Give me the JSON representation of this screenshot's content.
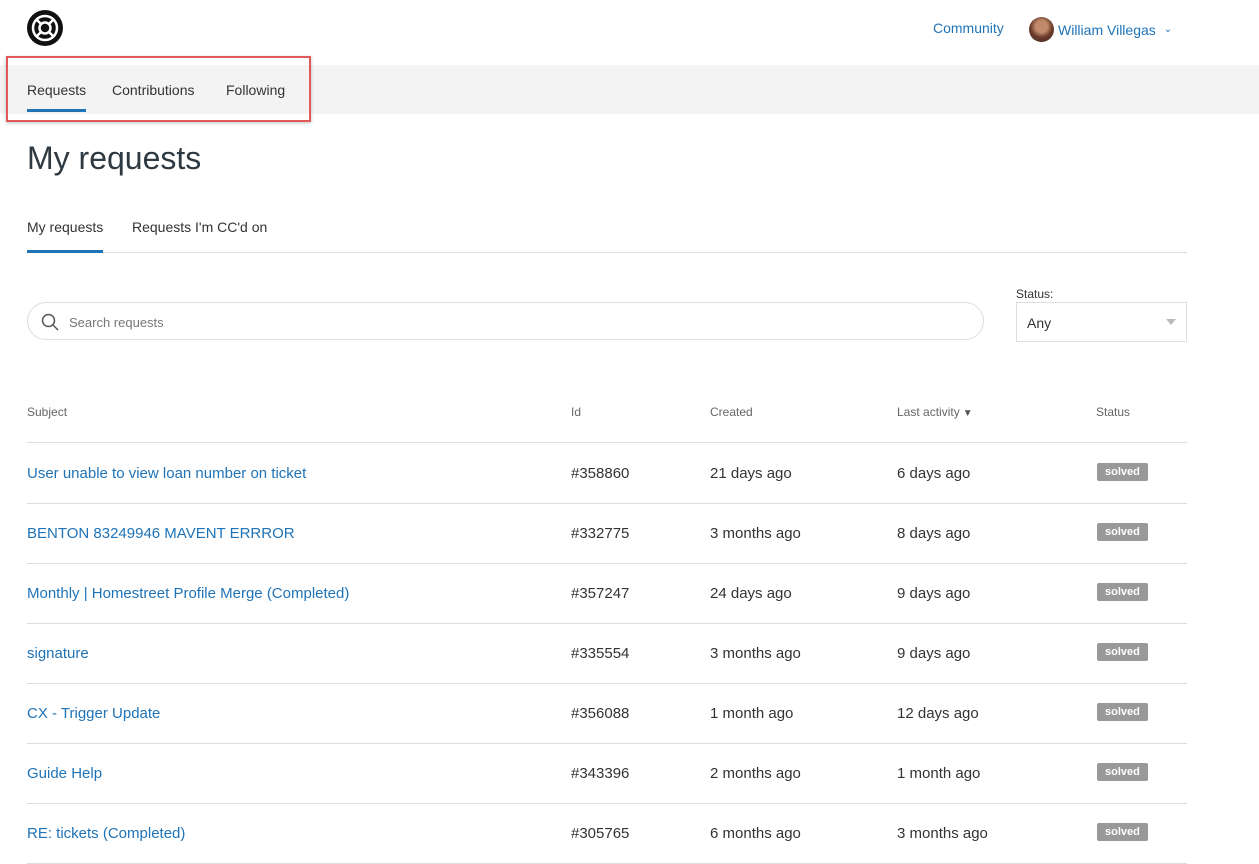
{
  "header": {
    "community_label": "Community",
    "user_name": "William Villegas"
  },
  "subnav": {
    "items": [
      {
        "label": "Requests",
        "active": true
      },
      {
        "label": "Contributions",
        "active": false
      },
      {
        "label": "Following",
        "active": false
      }
    ]
  },
  "page_title": "My requests",
  "tabs": [
    {
      "label": "My requests",
      "active": true
    },
    {
      "label": "Requests I'm CC'd on",
      "active": false
    }
  ],
  "search": {
    "placeholder": "Search requests",
    "value": ""
  },
  "status_filter": {
    "label": "Status:",
    "selected": "Any"
  },
  "table": {
    "columns": [
      "Subject",
      "Id",
      "Created",
      "Last activity",
      "Status"
    ],
    "rows": [
      {
        "subject": "User unable to view loan number on ticket",
        "id": "#358860",
        "created": "21 days ago",
        "last_activity": "6 days ago",
        "status": "solved"
      },
      {
        "subject": "BENTON 83249946 MAVENT ERRROR",
        "id": "#332775",
        "created": "3 months ago",
        "last_activity": "8 days ago",
        "status": "solved"
      },
      {
        "subject": "Monthly | Homestreet Profile Merge (Completed)",
        "id": "#357247",
        "created": "24 days ago",
        "last_activity": "9 days ago",
        "status": "solved"
      },
      {
        "subject": "signature",
        "id": "#335554",
        "created": "3 months ago",
        "last_activity": "9 days ago",
        "status": "solved"
      },
      {
        "subject": "CX - Trigger Update",
        "id": "#356088",
        "created": "1 month ago",
        "last_activity": "12 days ago",
        "status": "solved"
      },
      {
        "subject": "Guide Help",
        "id": "#343396",
        "created": "2 months ago",
        "last_activity": "1 month ago",
        "status": "solved"
      },
      {
        "subject": "RE: tickets (Completed)",
        "id": "#305765",
        "created": "6 months ago",
        "last_activity": "3 months ago",
        "status": "solved"
      }
    ]
  },
  "colors": {
    "accent": "#1f73b7",
    "badge": "#999999",
    "highlight": "#e05a5a"
  }
}
